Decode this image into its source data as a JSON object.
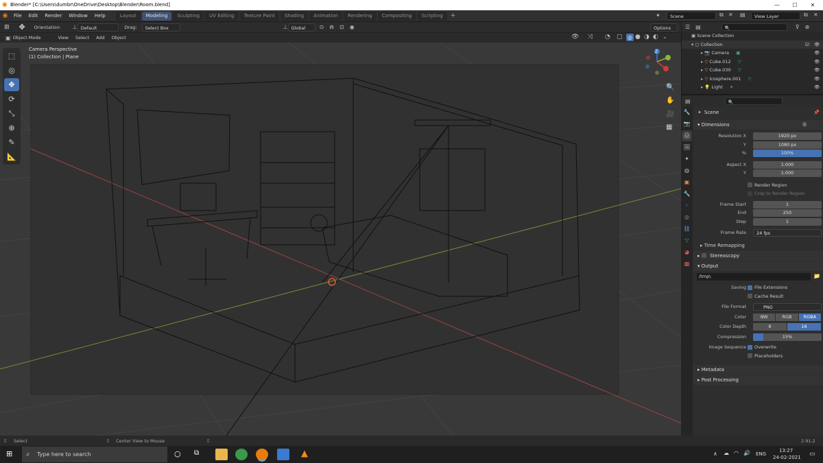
{
  "window": {
    "title": "Blender* [C:\\Users\\dumbr\\OneDrive\\Desktop\\Blender\\Room.blend]",
    "minimize": "—",
    "maximize": "☐",
    "close": "✕"
  },
  "menubar": {
    "items": [
      "File",
      "Edit",
      "Render",
      "Window",
      "Help"
    ],
    "workspaces": [
      "Layout",
      "Modeling",
      "Sculpting",
      "UV Editing",
      "Texture Paint",
      "Shading",
      "Animation",
      "Rendering",
      "Compositing",
      "Scripting"
    ],
    "active_workspace": "Modeling",
    "add_workspace": "+",
    "scene_name": "Scene",
    "view_layer": "View Layer"
  },
  "toolheader": {
    "orientation_label": "Orientation:",
    "orientation_value": "Default",
    "drag_label": "Drag:",
    "drag_value": "Select Box",
    "transform_orientation": "Global",
    "options": "Options"
  },
  "viewport_header": {
    "mode": "Object Mode",
    "menus": [
      "View",
      "Select",
      "Add",
      "Object"
    ]
  },
  "viewport": {
    "camera_label": "Camera Perspective",
    "collection_label": "(1) Collection | Plane",
    "axis_labels": [
      "Z",
      "Y",
      "X"
    ]
  },
  "toolbar": {
    "tools": [
      {
        "name": "select-box-tool",
        "glyph": "⬚",
        "active": false
      },
      {
        "name": "cursor-tool",
        "glyph": "◎",
        "active": false
      },
      {
        "name": "move-tool",
        "glyph": "✥",
        "active": true
      },
      {
        "name": "rotate-tool",
        "glyph": "⟳",
        "active": false
      },
      {
        "name": "scale-tool",
        "glyph": "⤡",
        "active": false
      },
      {
        "name": "transform-tool",
        "glyph": "⊕",
        "active": false
      },
      {
        "name": "annotate-tool",
        "glyph": "✎",
        "active": false
      },
      {
        "name": "measure-tool",
        "glyph": "📐",
        "active": false
      }
    ]
  },
  "outliner": {
    "root": "Scene Collection",
    "collection": "Collection",
    "items": [
      {
        "name": "Camera",
        "icon": "camera-icon"
      },
      {
        "name": "Cube.012",
        "icon": "mesh-icon"
      },
      {
        "name": "Cube.030",
        "icon": "mesh-icon"
      },
      {
        "name": "Icosphere.001",
        "icon": "mesh-icon"
      },
      {
        "name": "Light",
        "icon": "light-icon"
      }
    ]
  },
  "properties": {
    "context": "Scene",
    "dimensions": {
      "title": "Dimensions",
      "resolution_x_label": "Resolution X",
      "resolution_x": "1920 px",
      "y_label": "Y",
      "resolution_y": "1080 px",
      "percent_label": "%",
      "percent": "100%",
      "aspect_x_label": "Aspect X",
      "aspect_x": "1.000",
      "aspect_y": "1.000",
      "render_region": "Render Region",
      "crop_region": "Crop to Render Region",
      "frame_start_label": "Frame Start",
      "frame_start": "1",
      "end_label": "End",
      "frame_end": "250",
      "step_label": "Step",
      "frame_step": "1",
      "frame_rate_label": "Frame Rate",
      "frame_rate": "24 fps",
      "time_remapping": "Time Remapping"
    },
    "stereoscopy": "Stereoscopy",
    "output": {
      "title": "Output",
      "path": "/tmp\\",
      "saving_label": "Saving",
      "file_extensions": "File Extensions",
      "cache_result": "Cache Result",
      "file_format_label": "File Format",
      "file_format": "PNG",
      "color_label": "Color",
      "color_options": [
        "BW",
        "RGB",
        "RGBA"
      ],
      "color_active": 2,
      "depth_label": "Color Depth",
      "depth_options": [
        "8",
        "16"
      ],
      "depth_active": 1,
      "compression_label": "Compression",
      "compression": "15%",
      "compression_fraction": 0.15,
      "image_sequence_label": "Image Sequence",
      "overwrite": "Overwrite",
      "placeholders": "Placeholders"
    },
    "metadata": "Metadata",
    "post_processing": "Post Processing"
  },
  "statusbar": {
    "select": "Select",
    "center_view": "Center View to Mouse",
    "version": "2.91.2"
  },
  "taskbar": {
    "search_placeholder": "Type here to search",
    "language": "ENG",
    "time": "13:27",
    "date": "24-02-2021"
  },
  "colors": {
    "accent": "#4772b3",
    "x_axis": "#d03a3a",
    "y_axis": "#8ab53a",
    "z_axis": "#3a7ad0"
  }
}
